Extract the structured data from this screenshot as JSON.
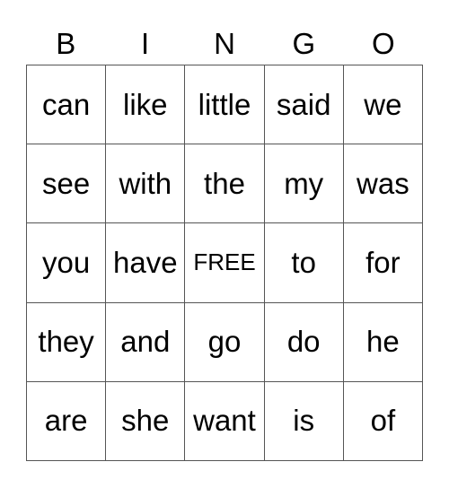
{
  "header": [
    "B",
    "I",
    "N",
    "G",
    "O"
  ],
  "rows": [
    [
      "can",
      "like",
      "little",
      "said",
      "we"
    ],
    [
      "see",
      "with",
      "the",
      "my",
      "was"
    ],
    [
      "you",
      "have",
      "FREE",
      "to",
      "for"
    ],
    [
      "they",
      "and",
      "go",
      "do",
      "he"
    ],
    [
      "are",
      "she",
      "want",
      "is",
      "of"
    ]
  ]
}
